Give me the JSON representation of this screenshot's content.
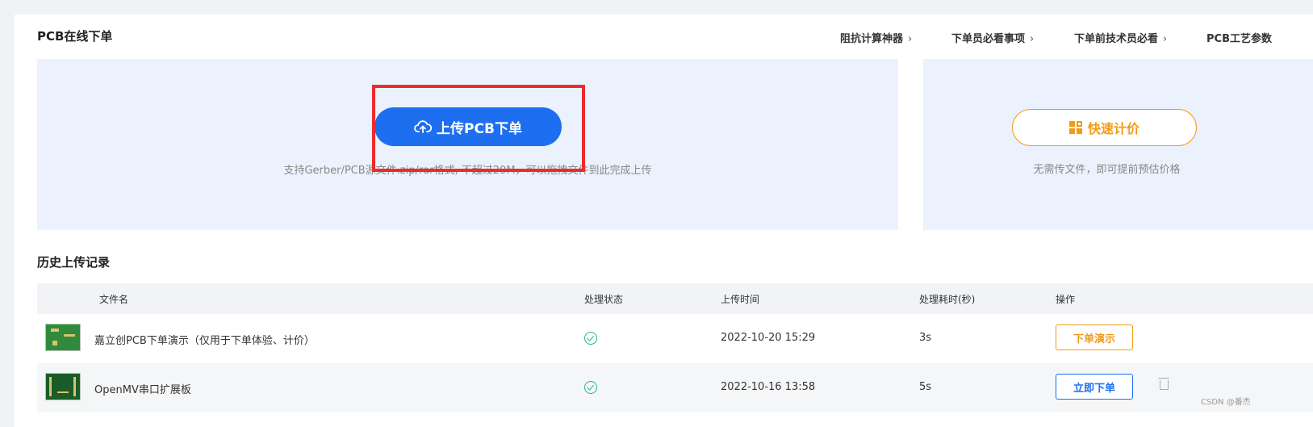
{
  "page_title": "PCB在线下单",
  "top_links": [
    {
      "label": "阻抗计算神器"
    },
    {
      "label": "下单员必看事项"
    },
    {
      "label": "下单前技术员必看"
    },
    {
      "label": "PCB工艺参数"
    }
  ],
  "upload": {
    "button_label": "上传PCB下单",
    "hint": "支持Gerber/PCB源文件.zip/rar格式, 不超过20M，可以拖拽文件到此完成上传"
  },
  "quick_quote": {
    "button_label": "快速计价",
    "hint": "无需传文件，即可提前预估价格"
  },
  "history": {
    "title": "历史上传记录",
    "columns": [
      "文件名",
      "处理状态",
      "上传时间",
      "处理耗时(秒)",
      "操作"
    ],
    "rows": [
      {
        "file_name": "嘉立创PCB下单演示（仅用于下单体验、计价）",
        "status": "success",
        "upload_time": "2022-10-20 15:29",
        "duration": "3s",
        "action_label": "下单演示",
        "action_style": "orange"
      },
      {
        "file_name": "OpenMV串口扩展板",
        "status": "success",
        "upload_time": "2022-10-16 13:58",
        "duration": "5s",
        "action_label": "立即下单",
        "action_style": "blue",
        "delete": true
      }
    ]
  },
  "watermark": "CSDN @番杰",
  "colors": {
    "primary": "#1e6ff0",
    "accent": "#f29b15",
    "success": "#1cb68e",
    "highlight": "#ec2b2b",
    "panel_bg": "#ebf2fd"
  }
}
